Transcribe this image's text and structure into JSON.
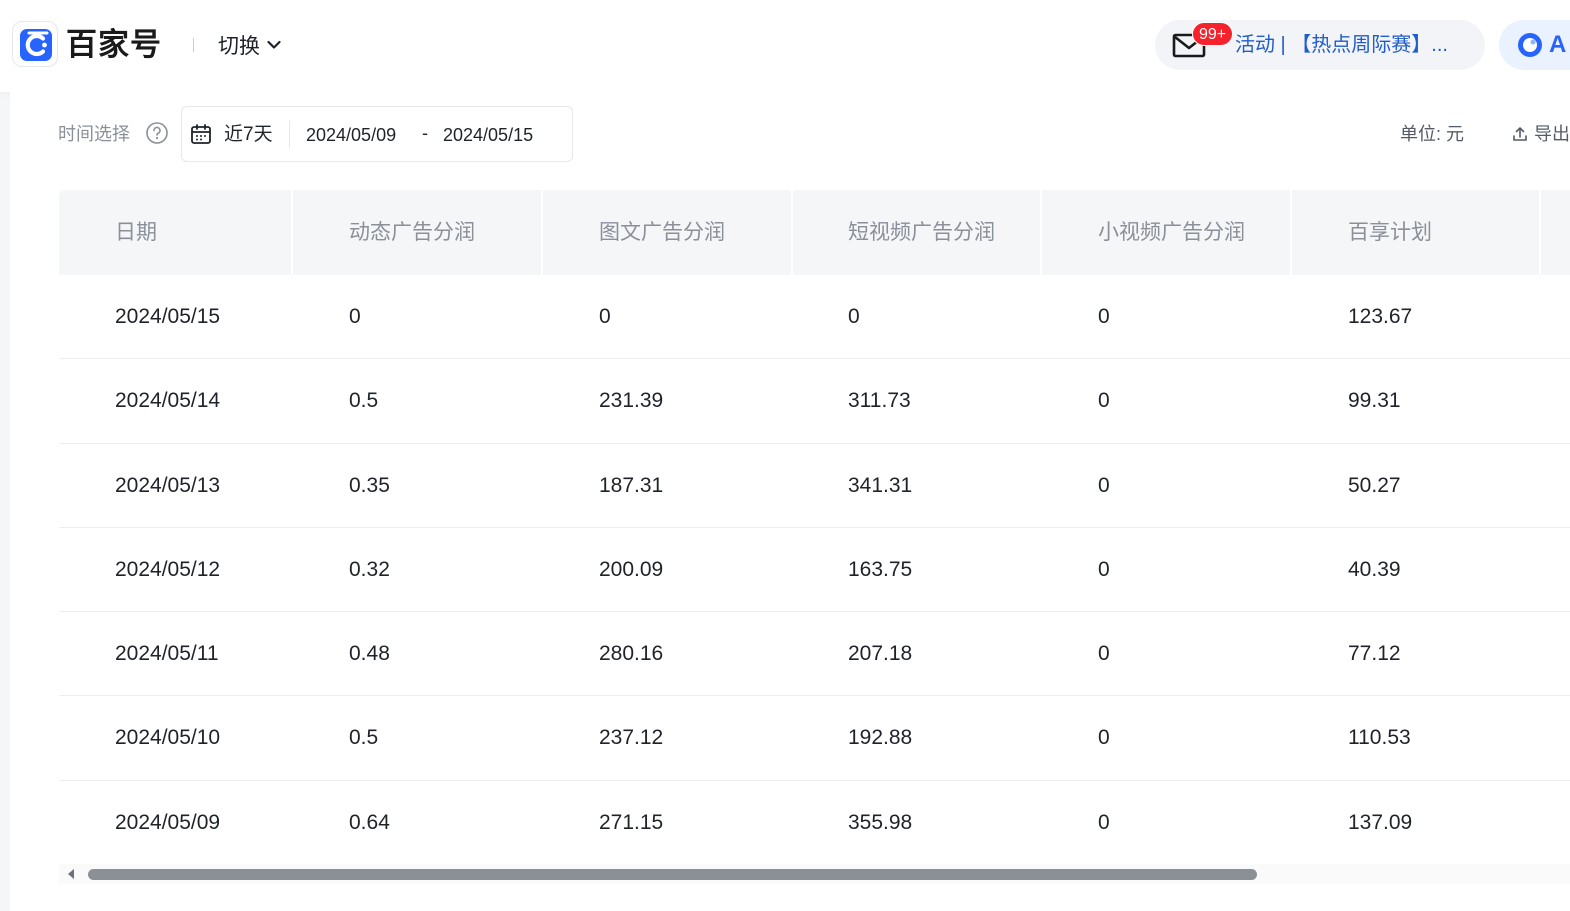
{
  "header": {
    "logo_text": "百家号",
    "switch_label": "切换",
    "notifications": {
      "badge": "99+",
      "text": "活动 | 【热点周际赛】..."
    },
    "ai_label": "A"
  },
  "filters": {
    "time_label": "时间选择",
    "preset": "近7天",
    "start_date": "2024/05/09",
    "separator": "-",
    "end_date": "2024/05/15",
    "unit": "单位: 元",
    "export_label": "导出"
  },
  "table": {
    "columns": [
      "日期",
      "动态广告分润",
      "图文广告分润",
      "短视频广告分润",
      "小视频广告分润",
      "百享计划"
    ],
    "rows": [
      [
        "2024/05/15",
        "0",
        "0",
        "0",
        "0",
        "123.67"
      ],
      [
        "2024/05/14",
        "0.5",
        "231.39",
        "311.73",
        "0",
        "99.31"
      ],
      [
        "2024/05/13",
        "0.35",
        "187.31",
        "341.31",
        "0",
        "50.27"
      ],
      [
        "2024/05/12",
        "0.32",
        "200.09",
        "163.75",
        "0",
        "40.39"
      ],
      [
        "2024/05/11",
        "0.48",
        "280.16",
        "207.18",
        "0",
        "77.12"
      ],
      [
        "2024/05/10",
        "0.5",
        "237.12",
        "192.88",
        "0",
        "110.53"
      ],
      [
        "2024/05/09",
        "0.64",
        "271.15",
        "355.98",
        "0",
        "137.09"
      ]
    ]
  },
  "colors": {
    "brand": "#2763ff",
    "notice_link": "#1f5ccc",
    "badge": "#f5222d",
    "header_bg": "#f5f6f8"
  }
}
